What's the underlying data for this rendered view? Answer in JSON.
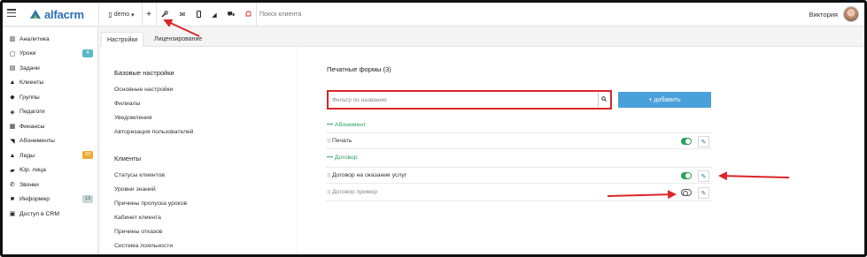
{
  "topbar": {
    "logo_text": "alfacrm",
    "branch_label": "demo",
    "search_placeholder": "Поиск клиента",
    "user_name": "Виктория",
    "icons": [
      "plus-icon",
      "wrench-icon",
      "mail-icon",
      "phone-icon",
      "telegram-icon",
      "cart-icon",
      "bell-icon"
    ]
  },
  "sidebar": {
    "items": [
      {
        "label": "Аналитика",
        "icon": "▥"
      },
      {
        "label": "Уроки",
        "icon": "▢",
        "badge": "4",
        "badge_color": "#5bb8c9"
      },
      {
        "label": "Задачи",
        "icon": "▤"
      },
      {
        "label": "Клиенты",
        "icon": "▲"
      },
      {
        "label": "Группы",
        "icon": "◆"
      },
      {
        "label": "Педагоги",
        "icon": "◈"
      },
      {
        "label": "Финансы",
        "icon": "▦"
      },
      {
        "label": "Абонементы",
        "icon": "◥"
      },
      {
        "label": "Лиды",
        "icon": "▲",
        "badge": "33",
        "badge_color": "#f0a830"
      },
      {
        "label": "Юр. лица",
        "icon": "▰"
      },
      {
        "label": "Звонки",
        "icon": "✆"
      },
      {
        "label": "Информер",
        "icon": "■",
        "badge": "13",
        "badge_color": "#c8d8d8"
      },
      {
        "label": "Доступ в CRM",
        "icon": "▣"
      }
    ]
  },
  "tabs": [
    "Настройки",
    "Лицензирование"
  ],
  "settings_nav": {
    "basic_title": "Базовые настройки",
    "basic_items": [
      "Основные настройки",
      "Филиалы",
      "Уведомления",
      "Авторизация пользователей"
    ],
    "clients_title": "Клиенты",
    "clients_items": [
      "Статусы клиентов",
      "Уровни знаний",
      "Причины пропуска уроков",
      "Кабинет клиента",
      "Причины отказов",
      "Система лояльности"
    ]
  },
  "main": {
    "title": "Печатные формы (3)",
    "filter_placeholder": "Фильтр по названию",
    "add_button": "+ добавить",
    "groups": [
      {
        "label": "••• Абонемент",
        "forms": [
          {
            "name": "Печать",
            "enabled": true
          }
        ]
      },
      {
        "label": "••• Договор",
        "forms": [
          {
            "name": "Договор на оказание услуг",
            "enabled": true
          },
          {
            "name": "Договор пример",
            "enabled": false
          }
        ]
      }
    ]
  },
  "colors": {
    "accent_blue": "#4aa0d8",
    "brand_blue": "#2a6fb4",
    "success_green": "#2aa05a",
    "highlight_red": "#d9262a"
  }
}
